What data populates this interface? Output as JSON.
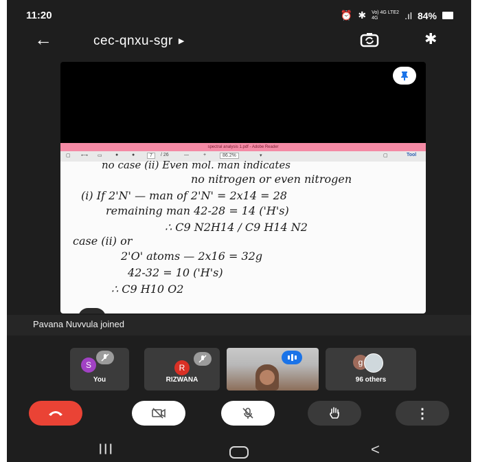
{
  "status_bar": {
    "time": "11:20",
    "network": "Vo) 4G LTE2 4G",
    "signal": ".ıl",
    "battery": "84%"
  },
  "top_bar": {
    "back_icon": "arrow-left-icon",
    "meeting_code": "cec-qnxu-sgr",
    "expand_icon": "triangle-right-icon",
    "switch_camera_icon": "switch-camera-icon",
    "bluetooth_icon": "bluetooth-icon"
  },
  "presentation": {
    "pin_icon": "pin-icon",
    "document_title": "spectral analysis 1.pdf - Adobe Reader",
    "toolbar": {
      "page_current": "7",
      "page_total": "/ 26",
      "zoom": "86.2%",
      "tools_label": "Tool"
    },
    "handwriting": [
      "no case (ii) Even mol. man indicates",
      "no nitrogen or even nitrogen",
      "(i)  If  2'N' — man of 2'N' =  2x14 = 28",
      "remaining man  42-28 = 14 ('H's)",
      "∴ C9 N2H14 / C9 H14 N2",
      "case (ii)      or",
      "2'O' atoms  —  2x16 = 32g",
      "42-32 =  10 ('H's)",
      "∴  C9 H10 O2"
    ]
  },
  "notification": {
    "text": "Pavana Nuvvula joined"
  },
  "participants": [
    {
      "initial": "S",
      "name": "You",
      "color": "#a142c4",
      "muted": true
    },
    {
      "initial": "R",
      "name": "RIZWANA",
      "color": "#d93025",
      "muted": true
    },
    {
      "initial": "",
      "name": "",
      "video": true,
      "speaking": true
    },
    {
      "initial": "g",
      "name": "96 others",
      "color": "#9e6b5b"
    }
  ],
  "controls": {
    "end_call_icon": "phone-hangup-icon",
    "camera_icon": "camera-off-icon",
    "mic_icon": "mic-off-icon",
    "hand_icon": "raise-hand-icon",
    "more_icon": "more-vertical-icon"
  },
  "nav": {
    "recents_glyph": "|||",
    "back_glyph": "<"
  },
  "colors": {
    "background": "#1e1e1e",
    "end_call": "#ea4335",
    "speaking": "#1a73e8",
    "doc_title_bar": "#f48aa5"
  }
}
